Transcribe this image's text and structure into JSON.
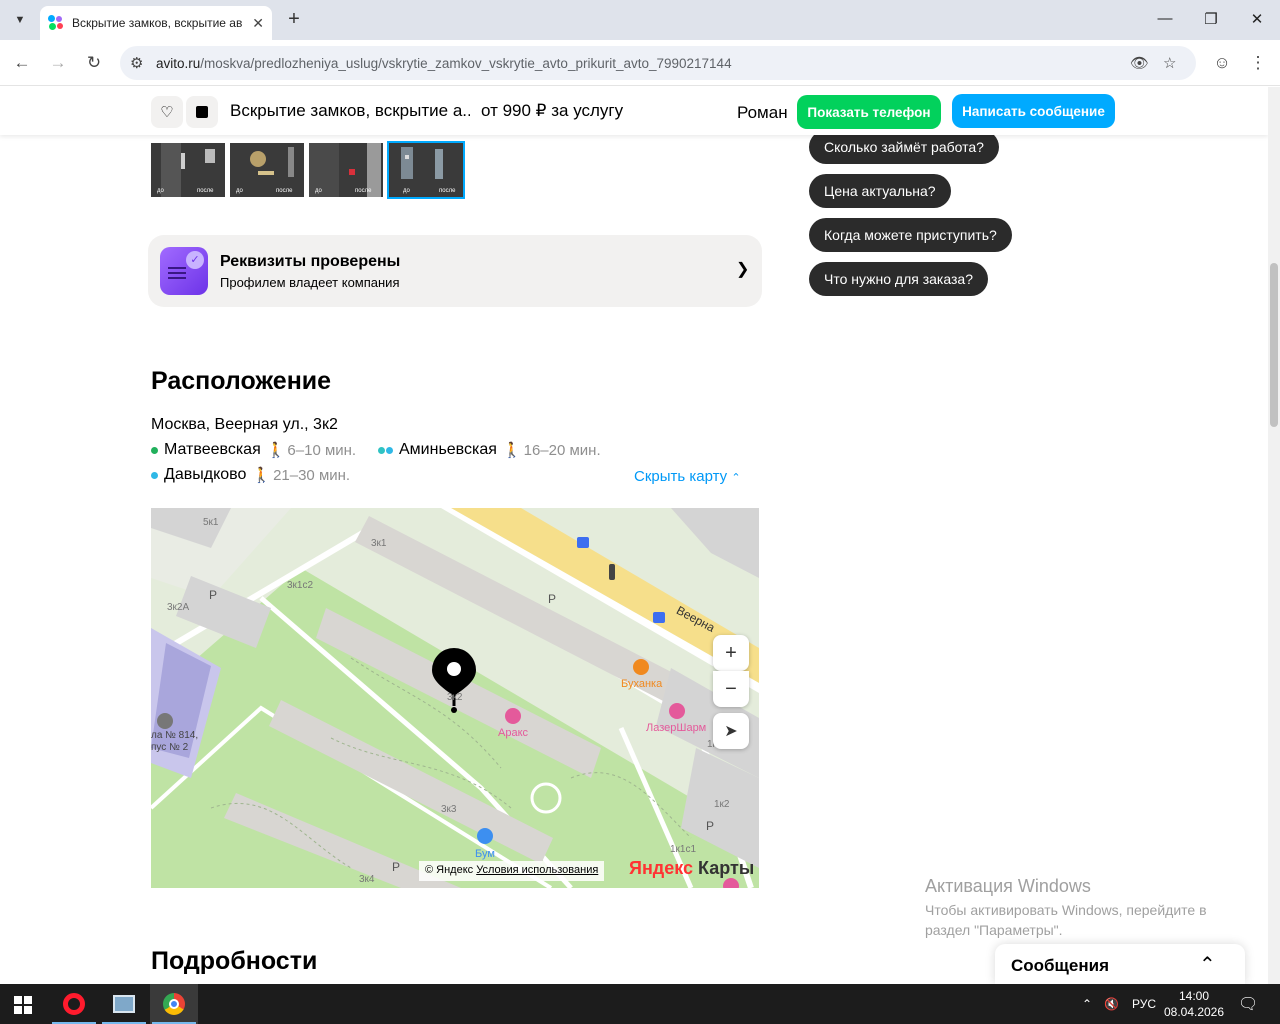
{
  "browser": {
    "tab_title": "Вскрытие замков, вскрытие ав",
    "url_host": "avito.ru",
    "url_path": "/moskva/predlozheniya_uslug/vskrytie_zamkov_vskrytie_avto_prikurit_avto_7990217144"
  },
  "sticky": {
    "title": "Вскрытие замков, вскрытие а...",
    "price": "от 990 ₽ за услугу",
    "seller": "Роман",
    "phone_btn": "Показать телефон",
    "message_btn": "Написать сообщение"
  },
  "thumbs": [
    {
      "before": "до",
      "after": "после"
    },
    {
      "before": "до",
      "after": "после"
    },
    {
      "before": "до",
      "after": "после"
    },
    {
      "before": "до",
      "after": "после"
    }
  ],
  "chips": [
    "Сколько займёт работа?",
    "Цена актуальна?",
    "Когда можете приступить?",
    "Что нужно для заказа?"
  ],
  "verify": {
    "title": "Реквизиты проверены",
    "subtitle": "Профилем владеет компания"
  },
  "location": {
    "heading": "Расположение",
    "address": "Москва, Веерная ул., 3к2",
    "metro": [
      {
        "name": "Матвеевская",
        "time": "6–10 мин.",
        "color": "#21b05c"
      },
      {
        "name": "Аминьевская",
        "time": "16–20 мин.",
        "color": "#2fc3c3"
      },
      {
        "name": "Давыдково",
        "time": "21–30 мин.",
        "color": "#2fb8e6"
      }
    ],
    "hide_map": "Скрыть карту"
  },
  "map": {
    "houses": [
      "5к1",
      "3к1",
      "3к1с2",
      "3к2А",
      "3к2",
      "3к3",
      "3к4",
      "1к2",
      "1к1с1",
      "1к"
    ],
    "street": "Веерна",
    "pois": [
      {
        "name": "Буханка",
        "color": "#f0891f"
      },
      {
        "name": "Аракс",
        "color": "#e45a9b"
      },
      {
        "name": "ЛазерШарм",
        "color": "#e45a9b"
      },
      {
        "name": "Бум",
        "color": "#3d8ff0"
      }
    ],
    "school": "ла № 814,\nпус № 2",
    "parking": "P",
    "copyright": "© Яндекс",
    "terms": "Условия использования",
    "logo_ya": "Яндекс",
    "logo_maps": "Карты"
  },
  "details_heading": "Подробности",
  "activation": {
    "title": "Активация Windows",
    "subtitle": "Чтобы активировать Windows, перейдите в раздел \"Параметры\"."
  },
  "messages_panel": "Сообщения",
  "taskbar": {
    "lang": "РУС",
    "time": "14:00",
    "date": "08.04.2026"
  }
}
